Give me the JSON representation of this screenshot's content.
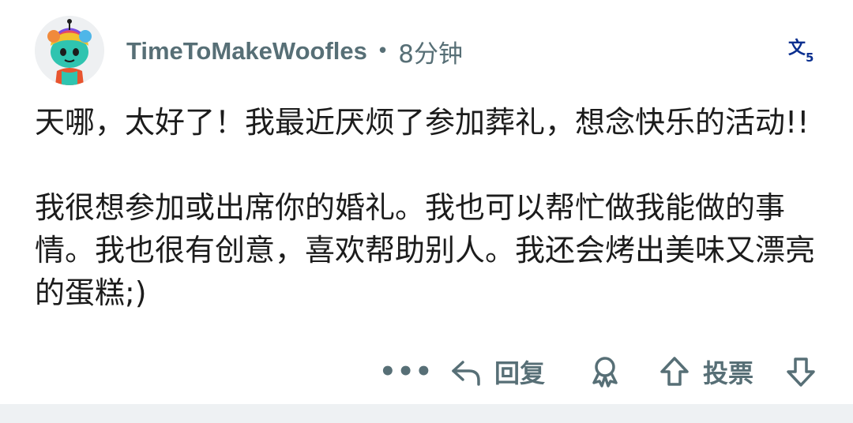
{
  "comment": {
    "username": "TimeToMakeWoofles",
    "separator": "•",
    "time": "8分钟",
    "paragraphs": [
      "天哪，太好了！我最近厌烦了参加葬礼，想念快乐的活动!!",
      "我很想参加或出席你的婚礼。我也可以帮忙做我能做的事情。我也很有创意，喜欢帮助别人。我还会烤出美味又漂亮的蛋糕;)"
    ]
  },
  "actions": {
    "more": "•••",
    "reply": "回复",
    "vote": "投票"
  },
  "icons": {
    "avatar": "snoo-avatar",
    "translate": "translate-icon",
    "reply": "reply-arrow-icon",
    "award": "award-icon",
    "upvote": "upvote-arrow-icon",
    "downvote": "downvote-arrow-icon"
  },
  "colors": {
    "meta_text": "#576f76",
    "body_text": "#1c1c1c",
    "translate_icon": "#0a2f8f",
    "avatar_bg": "#eef0f2",
    "footer_bg": "#eef1f3"
  }
}
